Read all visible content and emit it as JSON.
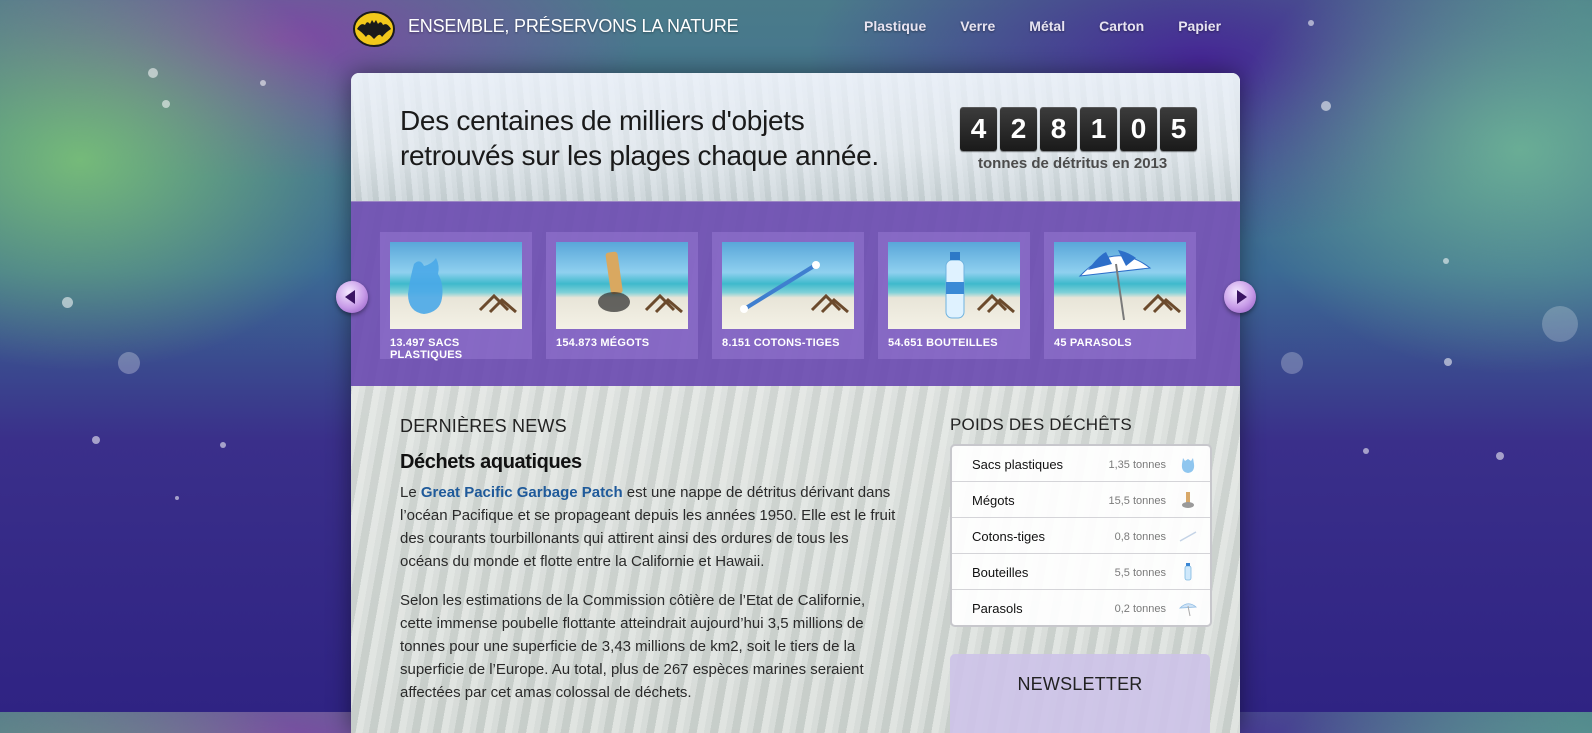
{
  "site": {
    "title": "ENSEMBLE, PRÉSERVONS LA NATURE"
  },
  "nav": [
    "Plastique",
    "Verre",
    "Métal",
    "Carton",
    "Papier"
  ],
  "hero": {
    "line1": "Des centaines de milliers d'objets",
    "line2": "retrouvés sur les plages chaque année.",
    "digits": [
      "4",
      "2",
      "8",
      "1",
      "0",
      "5"
    ],
    "counter_label": "tonnes de détritus en 2013"
  },
  "carousel": [
    {
      "caption": "13.497 SACS PLASTIQUES",
      "icon": "plastic-bag"
    },
    {
      "caption": "154.873 MÉGOTS",
      "icon": "cigarette-butt"
    },
    {
      "caption": "8.151 COTONS-TIGES",
      "icon": "cotton-swab"
    },
    {
      "caption": "54.651 BOUTEILLES",
      "icon": "bottle"
    },
    {
      "caption": "45 PARASOLS",
      "icon": "parasol"
    }
  ],
  "news": {
    "heading": "DERNIÈRES NEWS",
    "title": "Déchets aquatiques",
    "p1_prefix": "Le ",
    "p1_link": "Great Pacific Garbage Patch",
    "p1_rest": " est une nappe de détritus dérivant dans l’océan Pacifique et se propageant depuis les années 1950. Elle est le fruit des courants tourbillonants qui attirent ainsi des ordures de tous les océans du monde et flotte entre la Californie et Hawaii.",
    "p2": "Selon les estimations de la Commission côtière de l’Etat de Californie, cette immense poubelle flottante atteindrait aujourd’hui 3,5 millions de tonnes pour une superficie de 3,43 millions de km2, soit le tiers de la superficie de l’Europe. Au total, plus de 267 espèces marines seraient affectées par cet amas colossal de déchets."
  },
  "sidebar": {
    "heading": "POIDS DES DÉCHÊTS",
    "weights": [
      {
        "name": "Sacs plastiques",
        "value": "1,35 tonnes",
        "icon": "plastic-bag"
      },
      {
        "name": "Mégots",
        "value": "15,5 tonnes",
        "icon": "cigarette-butt"
      },
      {
        "name": "Cotons-tiges",
        "value": "0,8 tonnes",
        "icon": "cotton-swab"
      },
      {
        "name": "Bouteilles",
        "value": "5,5 tonnes",
        "icon": "bottle"
      },
      {
        "name": "Parasols",
        "value": "0,2 tonnes",
        "icon": "parasol"
      }
    ],
    "newsletter_heading": "NEWSLETTER"
  },
  "colors": {
    "purple_band": "#6848af",
    "link": "#1f5a9a",
    "background": "#2f2383"
  }
}
